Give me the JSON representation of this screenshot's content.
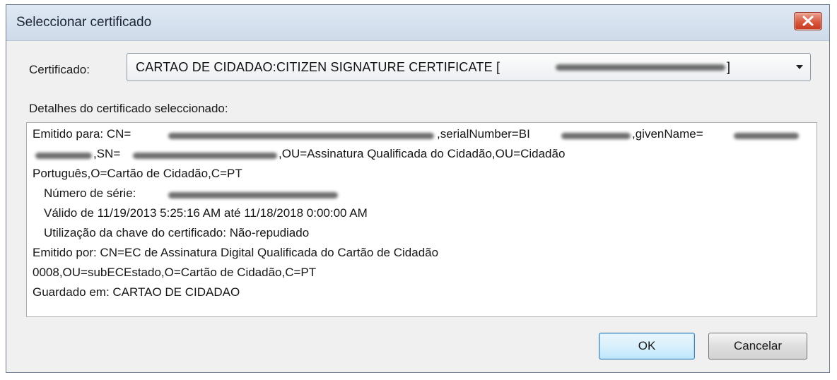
{
  "window": {
    "title": "Seleccionar certificado"
  },
  "certificate": {
    "label": "Certificado:",
    "selected_value": "CARTAO DE CIDADAO:CITIZEN SIGNATURE CERTIFICATE [",
    "selected_value_suffix": "]"
  },
  "details": {
    "label": "Detalhes do certificado seleccionado:",
    "lines": {
      "issued_to_prefix": "Emitido para: CN=",
      "issued_to_serial": ",serialNumber=BI",
      "issued_to_given": ",givenName=",
      "issued_to_sn": ",SN=",
      "issued_to_ou": ",OU=Assinatura Qualificada do Cidadão,OU=Cidadão",
      "issued_to_line3": "Português,O=Cartão de Cidadão,C=PT",
      "serial_number": "Número de série:",
      "validity": "Válido de 11/19/2013 5:25:16 AM até 11/18/2018 0:00:00 AM",
      "key_usage": "Utilização da chave do certificado: Não-repudiado",
      "issued_by_1": "Emitido por: CN=EC de Assinatura Digital Qualificada do Cartão de Cidadão",
      "issued_by_2": "0008,OU=subECEstado,O=Cartão de Cidadão,C=PT",
      "stored_in": "Guardado em: CARTAO DE CIDADAO"
    }
  },
  "buttons": {
    "ok": "OK",
    "cancel": "Cancelar"
  },
  "icons": {
    "close": "close-icon",
    "dropdown": "chevron-down-icon"
  },
  "colors": {
    "close_button": "#d8583e",
    "default_button_border": "#3c7fb1"
  }
}
